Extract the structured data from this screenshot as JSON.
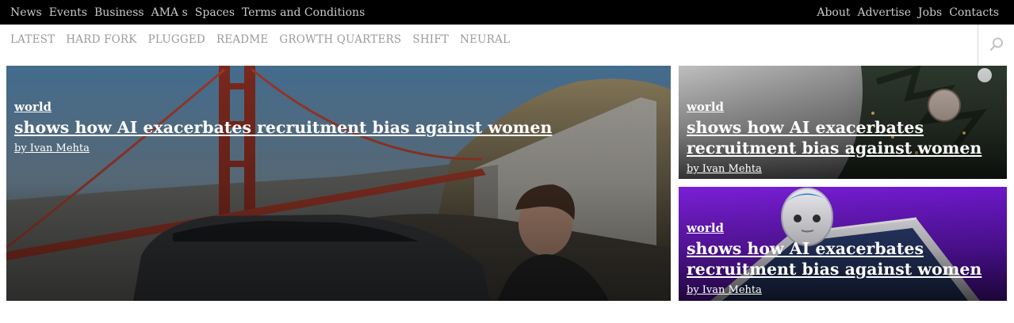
{
  "topnav": {
    "left": [
      "News",
      "Events",
      "Business",
      "AMA s",
      "Spaces",
      "Terms and Conditions"
    ],
    "right": [
      "About",
      "Advertise",
      "Jobs",
      "Contacts"
    ]
  },
  "catnav": [
    "LATEST",
    "HARD FORK",
    "PLUGGED",
    "README",
    "GROWTH QUARTERS",
    "SHIFT",
    "NEURAL"
  ],
  "search": {
    "icon": "search-icon"
  },
  "cards": [
    {
      "category": "world",
      "title": "shows how AI exacerbates recruitment bias against women",
      "author": "by Ivan Mehta",
      "image": "golden-gate-bridge-car-photo"
    },
    {
      "category": "world",
      "title": "shows how AI exacerbates recruitment bias against women",
      "author": "by Ivan Mehta",
      "image": "christmas-tree-ornaments-photo"
    },
    {
      "category": "world",
      "title": "shows how AI exacerbates recruitment bias against women",
      "author": "by Ivan Mehta",
      "image": "robot-purple-background-photo"
    }
  ],
  "colors": {
    "topbar_bg": "#000000",
    "topnav_text": "#c9c9c9",
    "catnav_text": "#9a9a9a",
    "card_text": "#ffffff",
    "robot_bg": "#7a1fd6"
  }
}
